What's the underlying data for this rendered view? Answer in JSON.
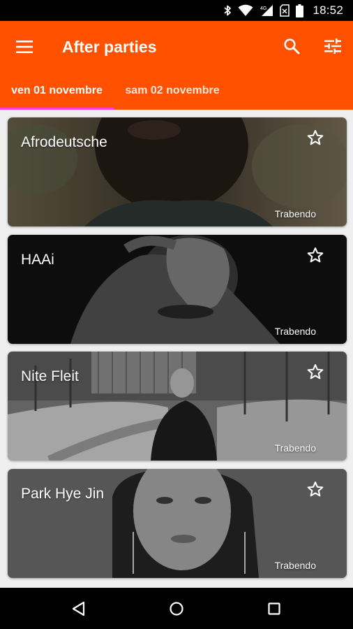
{
  "status_bar": {
    "time": "18:52",
    "icons": [
      "bluetooth-icon",
      "wifi-icon",
      "cell-signal-icon",
      "battery-icon"
    ]
  },
  "app_bar": {
    "title": "After parties",
    "menu_icon": "menu-icon",
    "search_icon": "search-icon",
    "filter_icon": "tune-icon",
    "background_color": "#ff5100",
    "indicator_color": "#ff3ddf"
  },
  "tabs": [
    {
      "label": "ven 01 novembre",
      "selected": true
    },
    {
      "label": "sam 02 novembre",
      "selected": false
    }
  ],
  "events": [
    {
      "title": "Afrodeutsche",
      "venue": "Trabendo",
      "favorite": false
    },
    {
      "title": "HAAi",
      "venue": "Trabendo",
      "favorite": false
    },
    {
      "title": "Nite Fleit",
      "venue": "Trabendo",
      "favorite": false
    },
    {
      "title": "Park Hye Jin",
      "venue": "Trabendo",
      "favorite": false
    }
  ],
  "nav_bar": {
    "icons": [
      "back-icon",
      "home-icon",
      "recents-icon"
    ]
  }
}
